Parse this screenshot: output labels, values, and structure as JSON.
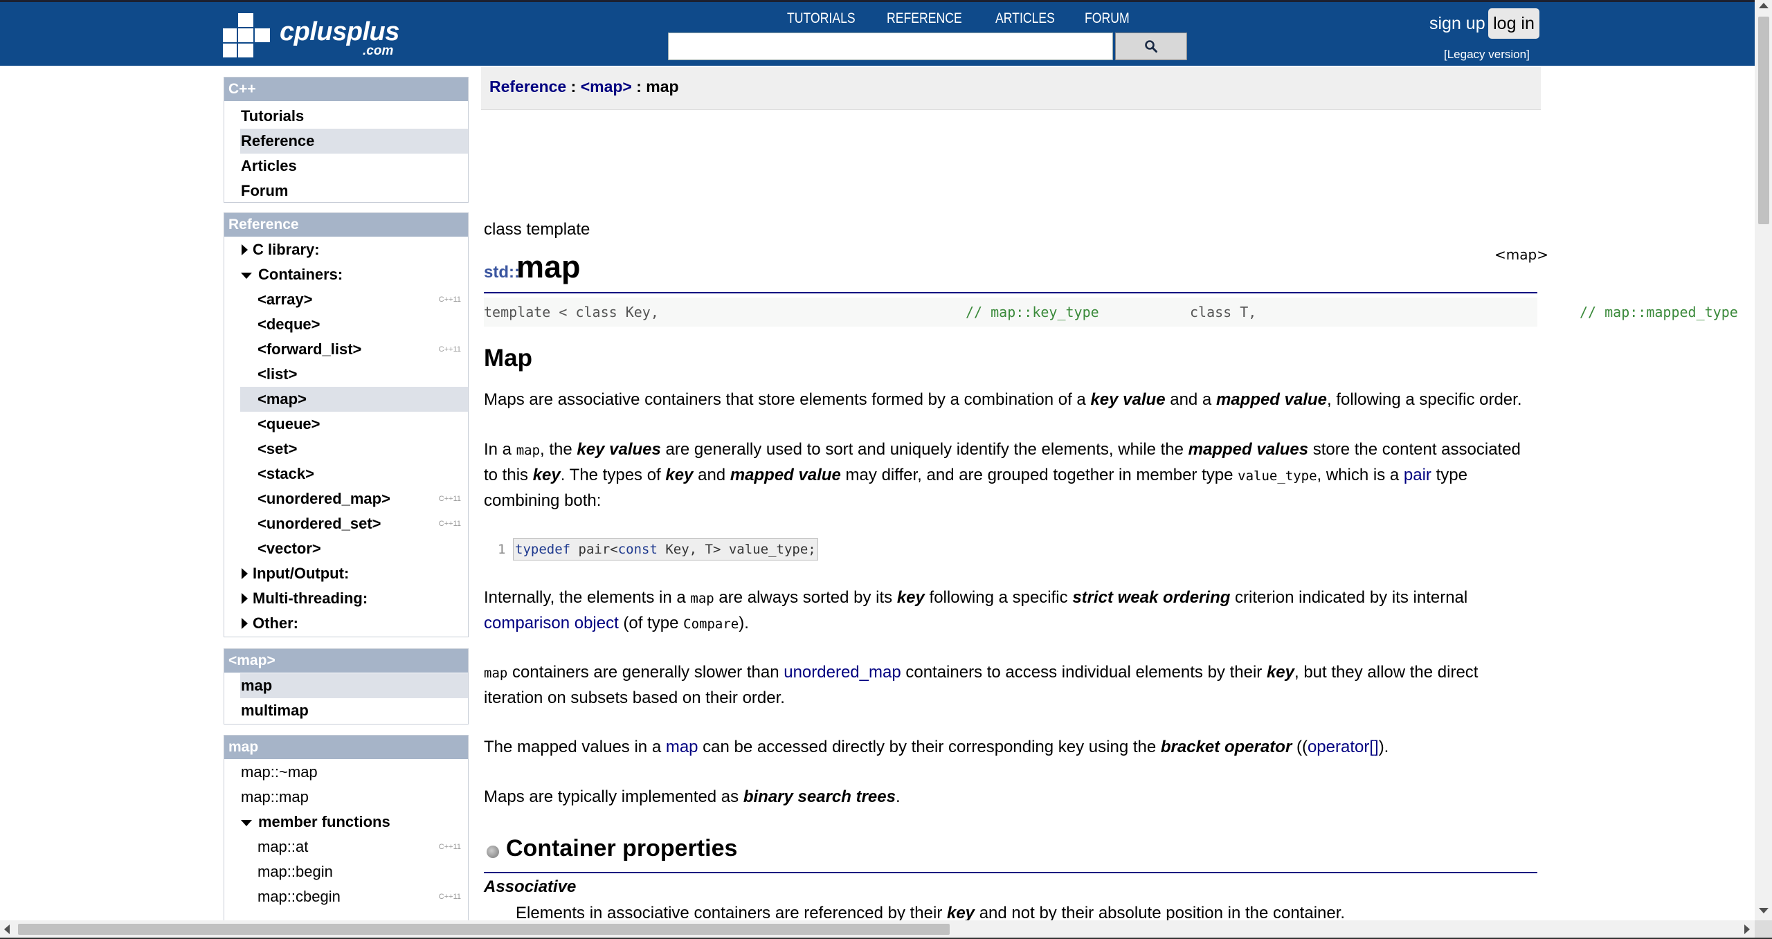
{
  "header": {
    "logo_text": "cplusplus",
    "logo_domain": ".com",
    "nav": [
      "TUTORIALS",
      "REFERENCE",
      "ARTICLES",
      "FORUM"
    ],
    "search_placeholder": "",
    "signup": "sign up",
    "login": "log in",
    "legacy": "[Legacy version]"
  },
  "sidebar": {
    "cpp": {
      "title": "C++",
      "items": [
        "Tutorials",
        "Reference",
        "Articles",
        "Forum"
      ],
      "selected": "Reference"
    },
    "reference": {
      "title": "Reference",
      "c_library": "C library:",
      "containers": "Containers:",
      "container_items": [
        {
          "label": "<array>",
          "badge": "C++11"
        },
        {
          "label": "<deque>",
          "badge": ""
        },
        {
          "label": "<forward_list>",
          "badge": "C++11"
        },
        {
          "label": "<list>",
          "badge": ""
        },
        {
          "label": "<map>",
          "badge": ""
        },
        {
          "label": "<queue>",
          "badge": ""
        },
        {
          "label": "<set>",
          "badge": ""
        },
        {
          "label": "<stack>",
          "badge": ""
        },
        {
          "label": "<unordered_map>",
          "badge": "C++11"
        },
        {
          "label": "<unordered_set>",
          "badge": "C++11"
        },
        {
          "label": "<vector>",
          "badge": ""
        }
      ],
      "input_output": "Input/Output:",
      "multithreading": "Multi-threading:",
      "other": "Other:"
    },
    "header_map": {
      "title": "<map>",
      "items": [
        "map",
        "multimap"
      ]
    },
    "map": {
      "title": "map",
      "items": [
        "map::~map",
        "map::map"
      ],
      "member_functions": "member functions",
      "members": [
        {
          "label": "map::at",
          "badge": "C++11"
        },
        {
          "label": "map::begin",
          "badge": ""
        },
        {
          "label": "map::cbegin",
          "badge": "C++11"
        }
      ]
    }
  },
  "breadcrumb": {
    "reference": "Reference",
    "sep1": " : ",
    "header": "<map>",
    "sep2": " : ",
    "current": "map"
  },
  "content": {
    "kind": "class template",
    "header_file": "<map>",
    "namespace": "std::",
    "name": "map",
    "prototype": {
      "line1": "template < class Key,",
      "comment1": "// map::key_type",
      "line2": "class T,",
      "comment2": "// map::mapped_type"
    },
    "section_title": "Map",
    "p1": {
      "a": "Maps are associative containers that store elements formed by a combination of a ",
      "b": "key value",
      "c": " and a ",
      "d": "mapped value",
      "e": ", following a specific order."
    },
    "p2": {
      "a": "In a ",
      "code1": "map",
      "b": ", the ",
      "c": "key values",
      "d": " are generally used to sort and uniquely identify the elements, while the ",
      "e": "mapped values",
      "f": " store the content associated to this ",
      "g": "key",
      "h": ". The types of ",
      "i": "key",
      "j": " and ",
      "k": "mapped value",
      "l": " may differ, and are grouped together in member type ",
      "code2": "value_type",
      "m": ", which is a ",
      "link": "pair",
      "n": " type combining both:"
    },
    "snippet": {
      "line_no": "1",
      "kw1": "typedef",
      "t1": " pair<",
      "kw2": "const",
      "t2": " Key, T> value_type;"
    },
    "p3": {
      "a": "Internally, the elements in a ",
      "code1": "map",
      "b": " are always sorted by its ",
      "c": "key",
      "d": " following a specific ",
      "e": "strict weak ordering",
      "f": " criterion indicated by its internal ",
      "link": "comparison object",
      "g": " (of type ",
      "code2": "Compare",
      "h": ")."
    },
    "p4": {
      "code1": "map",
      "a": " containers are generally slower than ",
      "link": "unordered_map",
      "b": " containers to access individual elements by their ",
      "c": "key",
      "d": ", but they allow the direct iteration on subsets based on their order."
    },
    "p5": {
      "a": "The mapped values in a ",
      "link1": "map",
      "b": " can be accessed directly by their corresponding key using the ",
      "c": "bracket operator",
      "d": " ((",
      "link2": "operator[]",
      "e": ")."
    },
    "p6": {
      "a": "Maps are typically implemented as ",
      "b": "binary search trees",
      "c": "."
    },
    "container_properties": "Container properties",
    "associative": "Associative",
    "associative_text_a": "Elements in associative containers are referenced by their ",
    "associative_text_b": "key",
    "associative_text_c": " and not by their absolute position in the container."
  },
  "colors": {
    "header_bg": "#0f4a8a",
    "sidebar_head": "#a6b4c8",
    "link": "#000080",
    "comment": "#3a8a3a"
  }
}
